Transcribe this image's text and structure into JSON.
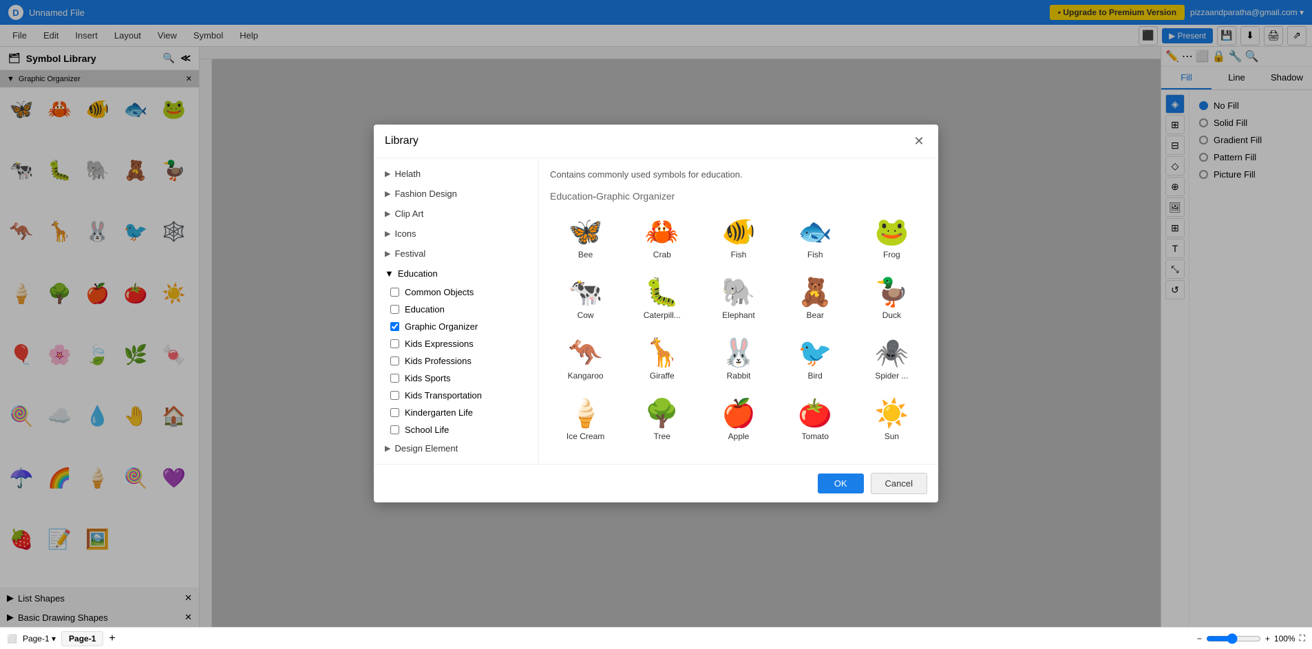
{
  "app": {
    "title": "Unnamed File",
    "logo": "D"
  },
  "topbar": {
    "upgrade_label": "• Upgrade to Premium Version",
    "user_email": "pizzaandparatha@gmail.com ▾"
  },
  "menubar": {
    "items": [
      "File",
      "Edit",
      "Insert",
      "Layout",
      "View",
      "Symbol",
      "Help"
    ]
  },
  "toolbar": {
    "present_label": "▶ Present"
  },
  "sidebar": {
    "header": "Symbol Library",
    "section_name": "Graphic Organizer",
    "symbols": [
      {
        "icon": "🦋",
        "label": "butterfly"
      },
      {
        "icon": "🦀",
        "label": "crab"
      },
      {
        "icon": "🐠",
        "label": "fish"
      },
      {
        "icon": "🐟",
        "label": "fish2"
      },
      {
        "icon": "🐸",
        "label": "frog"
      },
      {
        "icon": "🐄",
        "label": "cow"
      },
      {
        "icon": "🐛",
        "label": "caterpillar"
      },
      {
        "icon": "🐘",
        "label": "elephant"
      },
      {
        "icon": "🧸",
        "label": "bear"
      },
      {
        "icon": "🦆",
        "label": "duck"
      },
      {
        "icon": "🦘",
        "label": "kangaroo"
      },
      {
        "icon": "🦒",
        "label": "giraffe"
      },
      {
        "icon": "🐰",
        "label": "rabbit"
      },
      {
        "icon": "🐦",
        "label": "bird"
      },
      {
        "icon": "🕸️",
        "label": "spider"
      },
      {
        "icon": "🍦",
        "label": "ice cream"
      },
      {
        "icon": "🌳",
        "label": "tree"
      },
      {
        "icon": "🍎",
        "label": "apple"
      },
      {
        "icon": "🍅",
        "label": "tomato"
      },
      {
        "icon": "☀️",
        "label": "sun"
      },
      {
        "icon": "🎈",
        "label": "balloon"
      },
      {
        "icon": "🌸",
        "label": "flower"
      },
      {
        "icon": "🍃",
        "label": "leaf"
      },
      {
        "icon": "🌿",
        "label": "plant"
      },
      {
        "icon": "🍬",
        "label": "candy"
      },
      {
        "icon": "🍭",
        "label": "lollipop"
      },
      {
        "icon": "☁️",
        "label": "cloud"
      },
      {
        "icon": "💧",
        "label": "drop"
      },
      {
        "icon": "🤚",
        "label": "hand"
      },
      {
        "icon": "🏠",
        "label": "house"
      },
      {
        "icon": "☂️",
        "label": "umbrella"
      },
      {
        "icon": "🌈",
        "label": "rainbow"
      },
      {
        "icon": "🍭",
        "label": "lollipop2"
      },
      {
        "icon": "🍦",
        "label": "popsicle"
      },
      {
        "icon": "💜",
        "label": "heart"
      },
      {
        "icon": "🍓",
        "label": "strawberry"
      },
      {
        "icon": "📝",
        "label": "note"
      },
      {
        "icon": "🖼️",
        "label": "image"
      }
    ],
    "list_shapes": "List Shapes",
    "basic_drawing": "Basic Drawing Shapes"
  },
  "right_panel": {
    "tabs": [
      "Fill",
      "Line",
      "Shadow"
    ],
    "fill_options": [
      {
        "label": "No Fill",
        "selected": true
      },
      {
        "label": "Solid Fill",
        "selected": false
      },
      {
        "label": "Gradient Fill",
        "selected": false
      },
      {
        "label": "Pattern Fill",
        "selected": false
      },
      {
        "label": "Picture Fill",
        "selected": false
      }
    ]
  },
  "bottom_bar": {
    "page_dropdown": "Page-1 ▾",
    "page_label": "Page-1",
    "add_page": "+",
    "zoom": "100%"
  },
  "modal": {
    "title": "Library",
    "description": "Contains commonly used symbols for education.",
    "section_title": "Education",
    "section_subtitle": "Graphic Organizer",
    "sidebar_items": [
      {
        "label": "Helath",
        "type": "arrow",
        "expanded": false
      },
      {
        "label": "Fashion Design",
        "type": "arrow",
        "expanded": false
      },
      {
        "label": "Clip Art",
        "type": "arrow",
        "expanded": false
      },
      {
        "label": "Icons",
        "type": "arrow",
        "expanded": false
      },
      {
        "label": "Festival",
        "type": "arrow",
        "expanded": false
      },
      {
        "label": "Education",
        "type": "section",
        "expanded": true
      }
    ],
    "education_subitems": [
      {
        "label": "Common Objects",
        "checked": false
      },
      {
        "label": "Education",
        "checked": false
      },
      {
        "label": "Graphic Organizer",
        "checked": true
      },
      {
        "label": "Kids Expressions",
        "checked": false
      },
      {
        "label": "Kids Professions",
        "checked": false
      },
      {
        "label": "Kids Sports",
        "checked": false
      },
      {
        "label": "Kids Transportation",
        "checked": false
      },
      {
        "label": "Kindergarten Life",
        "checked": false
      },
      {
        "label": "School Life",
        "checked": false
      }
    ],
    "design_element": "Design Element",
    "symbols": [
      {
        "icon": "🦋",
        "label": "Bee"
      },
      {
        "icon": "🦀",
        "label": "Crab"
      },
      {
        "icon": "🐠",
        "label": "Fish"
      },
      {
        "icon": "🐟",
        "label": "Fish"
      },
      {
        "icon": "🐸",
        "label": "Frog"
      },
      {
        "icon": "🐄",
        "label": "Cow"
      },
      {
        "icon": "🐛",
        "label": "Caterpill..."
      },
      {
        "icon": "🐘",
        "label": "Elephant"
      },
      {
        "icon": "🧸",
        "label": "Bear"
      },
      {
        "icon": "🦆",
        "label": "Duck"
      },
      {
        "icon": "🦘",
        "label": "Kangaroo"
      },
      {
        "icon": "🦒",
        "label": "Giraffe"
      },
      {
        "icon": "🐰",
        "label": "Rabbit"
      },
      {
        "icon": "🐦",
        "label": "Bird"
      },
      {
        "icon": "🕷️",
        "label": "Spider ..."
      },
      {
        "icon": "🍦",
        "label": "Ice Cream"
      },
      {
        "icon": "🌳",
        "label": "Tree"
      },
      {
        "icon": "🍎",
        "label": "Apple"
      },
      {
        "icon": "🍅",
        "label": "Tomato"
      },
      {
        "icon": "☀️",
        "label": "Sun"
      }
    ],
    "ok_label": "OK",
    "cancel_label": "Cancel"
  }
}
